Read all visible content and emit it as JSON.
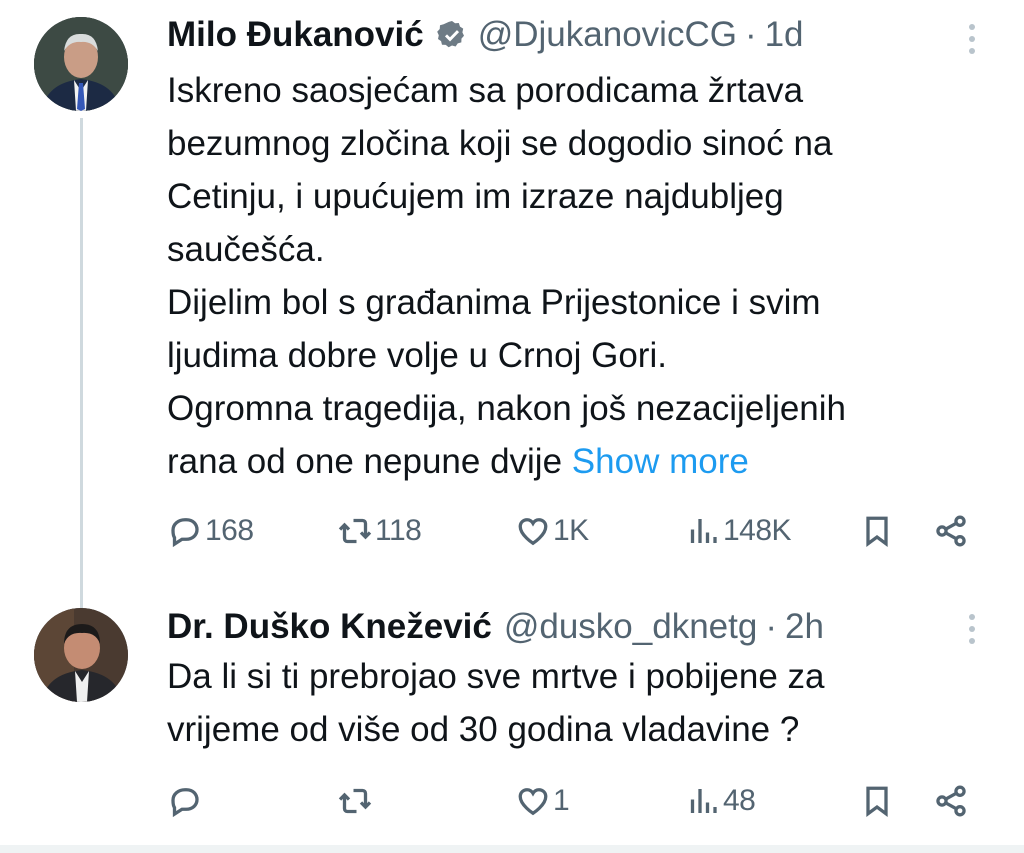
{
  "tweets": [
    {
      "name": "Milo Đukanović",
      "verified": true,
      "handle": "@DjukanovicCG",
      "separator": "·",
      "time": "1d",
      "lines": [
        "Iskreno saosjećam sa  porodicama žrtava",
        "bezumnog zločina koji se dogodio sinoć na",
        "Cetinju, i upućujem im izraze najdubljeg",
        "saučešća.",
        "Dijelim bol s građanima Prijestonice i svim",
        "ljudima dobre volje u Crnoj Gori.",
        "Ogromna tragedija, nakon još nezacijeljenih",
        "rana od one nepune dvije"
      ],
      "show_more": "Show more",
      "stats": {
        "replies": "168",
        "retweets": "118",
        "likes": "1K",
        "views": "148K"
      }
    },
    {
      "name": "Dr. Duško Knežević",
      "verified": false,
      "handle": "@dusko_dknetg",
      "separator": "·",
      "time": "2h",
      "lines": [
        "Da li si ti prebrojao sve mrtve i pobijene za",
        "vrijeme od više od 30 godina vladavine ?"
      ],
      "stats": {
        "replies": "",
        "retweets": "",
        "likes": "1",
        "views": "48"
      }
    }
  ],
  "icons": {
    "reply": "reply-icon",
    "retweet": "retweet-icon",
    "like": "heart-icon",
    "views": "views-icon",
    "bookmark": "bookmark-icon",
    "share": "share-icon",
    "more": "more-options-icon",
    "verified": "verified-badge-icon"
  },
  "colors": {
    "text": "#0f1419",
    "secondary": "#536471",
    "link": "#1d9bf0",
    "thread_line": "#cfd9de"
  }
}
